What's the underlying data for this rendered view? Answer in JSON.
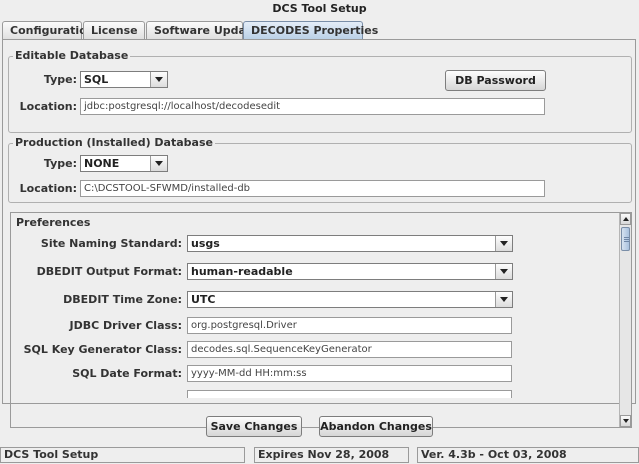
{
  "window": {
    "title": "DCS Tool Setup"
  },
  "tabs": [
    {
      "label": "Configuration",
      "selected": false
    },
    {
      "label": "License",
      "selected": false
    },
    {
      "label": "Software Update",
      "selected": false
    },
    {
      "label": "DECODES Properties",
      "selected": true
    }
  ],
  "editable_db": {
    "title": "Editable Database",
    "type_label": "Type:",
    "type_value": "SQL",
    "location_label": "Location:",
    "location_value": "jdbc:postgresql://localhost/decodesedit",
    "password_button": "DB Password"
  },
  "production_db": {
    "title": "Production (Installed) Database",
    "type_label": "Type:",
    "type_value": "NONE",
    "location_label": "Location:",
    "location_value": "C:\\DCSTOOL-SFWMD/installed-db"
  },
  "preferences": {
    "title": "Preferences",
    "rows": [
      {
        "label": "Site Naming Standard:",
        "value": "usgs"
      },
      {
        "label": "DBEDIT Output Format:",
        "value": "human-readable"
      },
      {
        "label": "DBEDIT Time Zone:",
        "value": "UTC"
      },
      {
        "label": "JDBC Driver Class:",
        "value": "org.postgresql.Driver"
      },
      {
        "label": "SQL Key Generator Class:",
        "value": "decodes.sql.SequenceKeyGenerator"
      },
      {
        "label": "SQL Date Format:",
        "value": "yyyy-MM-dd HH:mm:ss"
      }
    ]
  },
  "buttons": {
    "save": "Save Changes",
    "abandon": "Abandon Changes"
  },
  "status": {
    "app": "DCS Tool Setup",
    "expires": "Expires Nov 28, 2008",
    "version": "Ver. 4.3b - Oct 03, 2008"
  },
  "icons": {
    "dropdown": "chevron-down-icon",
    "scroll_up": "arrow-up-icon",
    "scroll_down": "arrow-down-icon"
  }
}
